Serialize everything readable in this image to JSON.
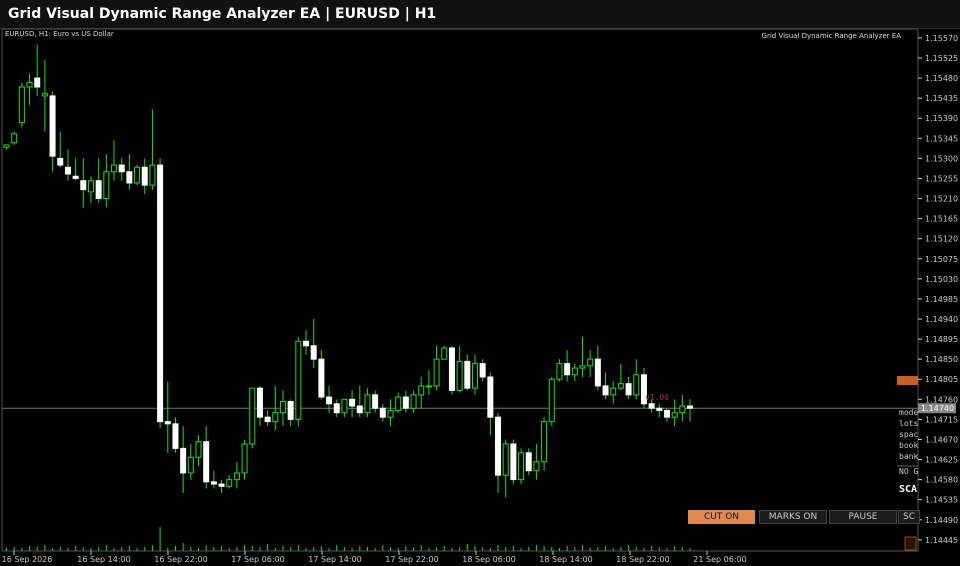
{
  "window": {
    "title": "Grid Visual Dynamic Range Analyzer EA  |  EURUSD  |  H1"
  },
  "chart": {
    "symbol_label": "EURUSD, H1:  Euro vs US Dollar",
    "ea_name": "Grid Visual Dynamic Range Analyzer EA",
    "current_price": "1.14740",
    "version_label": "v1.00",
    "panel_lines": [
      "mode",
      "lots",
      "spac",
      "book",
      "bank",
      "NO G",
      "SCA"
    ],
    "price_ticks": [
      "1.15570",
      "1.15525",
      "1.15480",
      "1.15435",
      "1.15390",
      "1.15345",
      "1.15300",
      "1.15255",
      "1.15210",
      "1.15165",
      "1.15120",
      "1.15075",
      "1.15030",
      "1.14985",
      "1.14940",
      "1.14895",
      "1.14850",
      "1.14805",
      "1.14760",
      "1.14715",
      "1.14670",
      "1.14625",
      "1.14580",
      "1.14535",
      "1.14490",
      "1.14445"
    ],
    "time_ticks": [
      "16 Sep 2026",
      "16 Sep 14:00",
      "16 Sep 22:00",
      "17 Sep 06:00",
      "17 Sep 14:00",
      "17 Sep 22:00",
      "18 Sep 06:00",
      "18 Sep 14:00",
      "18 Sep 22:00",
      "21 Sep 06:00"
    ]
  },
  "buttons": {
    "cut": "CUT ON",
    "marks": "MARKS ON",
    "pause": "PAUSE",
    "sc": "SC"
  },
  "colors": {
    "bull": "#000000",
    "bull_wick": "#1fdc1f",
    "bear": "#ffffff",
    "axis": "#cccccc",
    "accent": "#e08a4e"
  },
  "chart_data": {
    "type": "candlestick",
    "candles": [
      [
        1.15325,
        1.1533,
        1.1532,
        1.1533
      ],
      [
        1.15335,
        1.1536,
        1.1533,
        1.15355
      ],
      [
        1.1538,
        1.1547,
        1.1537,
        1.1546
      ],
      [
        1.1546,
        1.1549,
        1.1542,
        1.1547
      ],
      [
        1.1548,
        1.15555,
        1.1544,
        1.1546
      ],
      [
        1.1544,
        1.1552,
        1.1536,
        1.15445
      ],
      [
        1.1544,
        1.1545,
        1.1527,
        1.15305
      ],
      [
        1.153,
        1.1536,
        1.1528,
        1.15285
      ],
      [
        1.1528,
        1.1532,
        1.1525,
        1.15265
      ],
      [
        1.1526,
        1.153,
        1.1525,
        1.15255
      ],
      [
        1.1525,
        1.153,
        1.1519,
        1.1523
      ],
      [
        1.15225,
        1.1526,
        1.152,
        1.1525
      ],
      [
        1.1525,
        1.153,
        1.152,
        1.1521
      ],
      [
        1.1521,
        1.1531,
        1.1519,
        1.1527
      ],
      [
        1.1527,
        1.1534,
        1.1525,
        1.15285
      ],
      [
        1.15285,
        1.153,
        1.1525,
        1.1527
      ],
      [
        1.1527,
        1.1531,
        1.1523,
        1.15245
      ],
      [
        1.15245,
        1.15285,
        1.1524,
        1.1528
      ],
      [
        1.1528,
        1.153,
        1.1522,
        1.1524
      ],
      [
        1.1524,
        1.1541,
        1.1523,
        1.15285
      ],
      [
        1.15285,
        1.153,
        1.14695,
        1.1471
      ],
      [
        1.1471,
        1.148,
        1.1464,
        1.14705
      ],
      [
        1.14705,
        1.1472,
        1.1464,
        1.1465
      ],
      [
        1.1465,
        1.147,
        1.1455,
        1.14595
      ],
      [
        1.14595,
        1.1466,
        1.1458,
        1.1463
      ],
      [
        1.1463,
        1.1468,
        1.1461,
        1.14665
      ],
      [
        1.14665,
        1.147,
        1.1456,
        1.14575
      ],
      [
        1.14575,
        1.146,
        1.1456,
        1.1457
      ],
      [
        1.1457,
        1.1458,
        1.1455,
        1.14565
      ],
      [
        1.14565,
        1.1459,
        1.1456,
        1.1458
      ],
      [
        1.1458,
        1.1462,
        1.1456,
        1.14595
      ],
      [
        1.14595,
        1.1467,
        1.1458,
        1.1466
      ],
      [
        1.1466,
        1.1478,
        1.1465,
        1.14785
      ],
      [
        1.14785,
        1.1479,
        1.147,
        1.1472
      ],
      [
        1.1472,
        1.14735,
        1.147,
        1.1471
      ],
      [
        1.1471,
        1.1479,
        1.1469,
        1.1473
      ],
      [
        1.1473,
        1.1478,
        1.147,
        1.14755
      ],
      [
        1.14755,
        1.1476,
        1.147,
        1.14715
      ],
      [
        1.14715,
        1.149,
        1.147,
        1.1489
      ],
      [
        1.1489,
        1.14915,
        1.1486,
        1.1488
      ],
      [
        1.1488,
        1.1494,
        1.1483,
        1.1485
      ],
      [
        1.1485,
        1.1487,
        1.1476,
        1.14765
      ],
      [
        1.14765,
        1.1479,
        1.1473,
        1.1475
      ],
      [
        1.1475,
        1.1476,
        1.1472,
        1.1473
      ],
      [
        1.1473,
        1.1476,
        1.1472,
        1.1476
      ],
      [
        1.1476,
        1.1478,
        1.1472,
        1.14745
      ],
      [
        1.14745,
        1.1479,
        1.1472,
        1.1473
      ],
      [
        1.1473,
        1.14785,
        1.1472,
        1.1477
      ],
      [
        1.1477,
        1.1478,
        1.1473,
        1.1474
      ],
      [
        1.1474,
        1.1475,
        1.1471,
        1.1472
      ],
      [
        1.1472,
        1.1476,
        1.147,
        1.14735
      ],
      [
        1.14735,
        1.14775,
        1.1473,
        1.14765
      ],
      [
        1.14765,
        1.1478,
        1.1473,
        1.1474
      ],
      [
        1.1474,
        1.1478,
        1.1473,
        1.1477
      ],
      [
        1.1477,
        1.1481,
        1.1474,
        1.1479
      ],
      [
        1.1479,
        1.14825,
        1.1477,
        1.1479
      ],
      [
        1.1479,
        1.1488,
        1.1478,
        1.1485
      ],
      [
        1.1485,
        1.1488,
        1.1485,
        1.14875
      ],
      [
        1.14875,
        1.1488,
        1.1477,
        1.1478
      ],
      [
        1.1478,
        1.1488,
        1.14775,
        1.14845
      ],
      [
        1.14845,
        1.1486,
        1.1478,
        1.14785
      ],
      [
        1.14785,
        1.1486,
        1.1477,
        1.1484
      ],
      [
        1.1484,
        1.1485,
        1.148,
        1.1481
      ],
      [
        1.1481,
        1.1482,
        1.1468,
        1.1472
      ],
      [
        1.1472,
        1.1473,
        1.1455,
        1.1459
      ],
      [
        1.1459,
        1.1467,
        1.1454,
        1.1466
      ],
      [
        1.1466,
        1.1467,
        1.1457,
        1.1458
      ],
      [
        1.1458,
        1.1465,
        1.1457,
        1.1464
      ],
      [
        1.1464,
        1.1465,
        1.1459,
        1.146
      ],
      [
        1.146,
        1.1466,
        1.1458,
        1.1462
      ],
      [
        1.1462,
        1.1472,
        1.146,
        1.1471
      ],
      [
        1.1471,
        1.1481,
        1.147,
        1.14805
      ],
      [
        1.14805,
        1.1485,
        1.148,
        1.1484
      ],
      [
        1.1484,
        1.1487,
        1.148,
        1.14815
      ],
      [
        1.14815,
        1.1484,
        1.148,
        1.1483
      ],
      [
        1.1483,
        1.149,
        1.1481,
        1.14835
      ],
      [
        1.14835,
        1.1487,
        1.1481,
        1.1485
      ],
      [
        1.1485,
        1.1488,
        1.1478,
        1.1479
      ],
      [
        1.1479,
        1.1482,
        1.1476,
        1.1477
      ],
      [
        1.1477,
        1.148,
        1.1475,
        1.14785
      ],
      [
        1.14785,
        1.1484,
        1.1478,
        1.14795
      ],
      [
        1.14795,
        1.1481,
        1.1476,
        1.1477
      ],
      [
        1.1477,
        1.1485,
        1.1476,
        1.14815
      ],
      [
        1.14815,
        1.1483,
        1.1474,
        1.1475
      ],
      [
        1.1475,
        1.1476,
        1.1473,
        1.1474
      ],
      [
        1.1474,
        1.1475,
        1.1472,
        1.14735
      ],
      [
        1.14735,
        1.1474,
        1.1471,
        1.1472
      ],
      [
        1.1472,
        1.1476,
        1.147,
        1.1473
      ],
      [
        1.1473,
        1.1477,
        1.1471,
        1.14745
      ],
      [
        1.14745,
        1.1476,
        1.1471,
        1.1474
      ]
    ],
    "ylim": [
      1.1442,
      1.1559
    ]
  }
}
